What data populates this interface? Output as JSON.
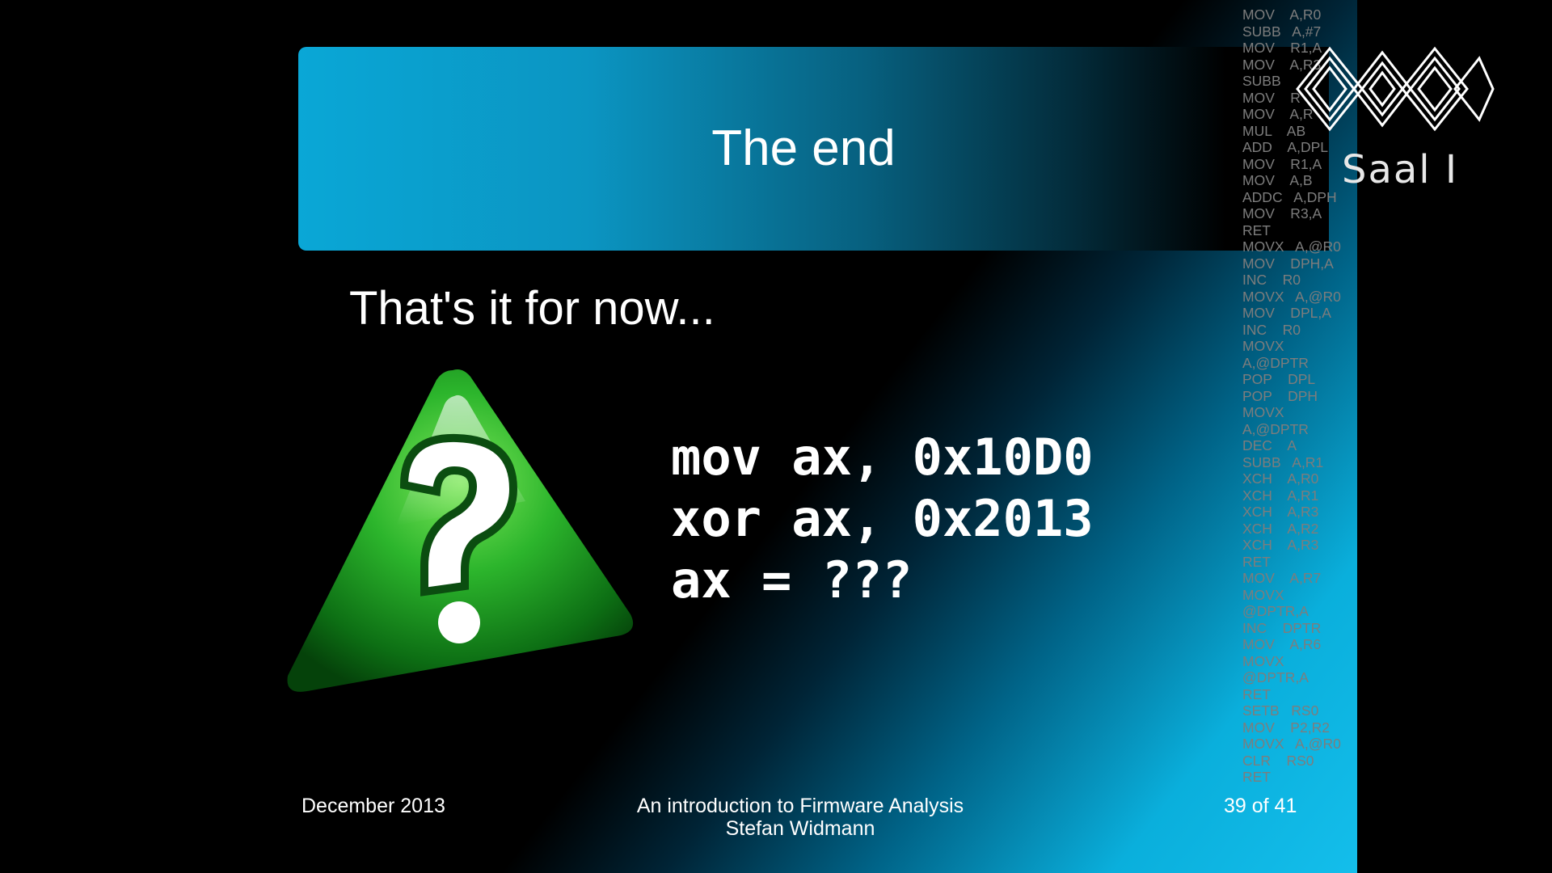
{
  "slide": {
    "title": "The end",
    "subtitle": "That's it for now...",
    "code_lines": [
      "mov ax, 0x10D0",
      "xor ax, 0x2013",
      "ax = ???"
    ]
  },
  "logo": {
    "text": "Saal I"
  },
  "assembly_listing": [
    "MOV    A,R0",
    "SUBB   A,#7",
    "MOV    R1,A",
    "MOV    A,R3",
    "SUBB   ",
    "MOV    R",
    "MOV    A,R",
    "MUL    AB",
    "ADD    A,DPL",
    "MOV    R1,A",
    "MOV    A,B",
    "ADDC   A,DPH",
    "MOV    R3,A",
    "RET",
    "MOVX   A,@R0",
    "MOV    DPH,A",
    "INC    R0",
    "MOVX   A,@R0",
    "MOV    DPL,A",
    "INC    R0",
    "MOVX",
    "A,@DPTR",
    "POP    DPL",
    "POP    DPH",
    "MOVX",
    "A,@DPTR",
    "DEC    A",
    "SUBB   A,R1",
    "XCH    A,R0",
    "XCH    A,R1",
    "XCH    A,R3",
    "XCH    A,R2",
    "XCH    A,R3",
    "RET",
    "MOV    A,R7",
    "MOVX",
    "@DPTR,A",
    "INC    DPTR",
    "MOV    A,R6",
    "MOVX",
    "@DPTR,A",
    "RET",
    "SETB   RS0",
    "MOV    P2,R2",
    "MOVX   A,@R0",
    "CLR    RS0",
    "RET"
  ],
  "footer": {
    "date": "December 2013",
    "talk_title": "An introduction to Firmware Analysis",
    "speaker": "Stefan Widmann",
    "page": "39 of 41"
  },
  "colors": {
    "title_bar_start": "#0aa7d6",
    "glow": "#14bee8",
    "warning_green": "#1fa82a",
    "text": "#ffffff",
    "assembly_text": "#7d7d7d"
  },
  "icons": {
    "warning": "green-triangle-question-mark-icon",
    "logo": "saal-logo-icon"
  }
}
